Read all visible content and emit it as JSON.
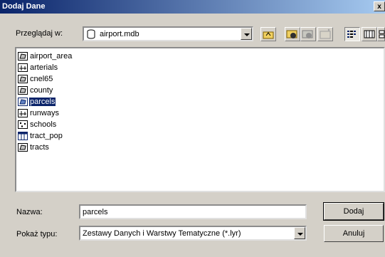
{
  "window": {
    "title": "Dodaj Dane",
    "close_glyph": "x"
  },
  "lookin": {
    "label": "Przeglądaj w:",
    "value": "airport.mdb",
    "icon": "database-icon"
  },
  "toolbar": {
    "buttons": [
      {
        "name": "up-one-level-icon"
      },
      {
        "name": "connect-folder-icon"
      },
      {
        "name": "disconnect-folder-icon"
      },
      {
        "name": "new-folder-icon"
      },
      {
        "name": "list-view-icon"
      },
      {
        "name": "details-view-icon"
      },
      {
        "name": "thumbnails-view-icon"
      }
    ]
  },
  "files": [
    {
      "label": "airport_area",
      "icon": "polygon-layer-icon",
      "selected": false
    },
    {
      "label": "arterials",
      "icon": "line-layer-icon",
      "selected": false
    },
    {
      "label": "cnel65",
      "icon": "polygon-layer-icon",
      "selected": false
    },
    {
      "label": "county",
      "icon": "polygon-layer-icon",
      "selected": false
    },
    {
      "label": "parcels",
      "icon": "polygon-layer-icon",
      "selected": true
    },
    {
      "label": "runways",
      "icon": "line-layer-icon",
      "selected": false
    },
    {
      "label": "schools",
      "icon": "point-layer-icon",
      "selected": false
    },
    {
      "label": "tract_pop",
      "icon": "table-icon",
      "selected": false
    },
    {
      "label": "tracts",
      "icon": "polygon-layer-icon",
      "selected": false
    }
  ],
  "name_field": {
    "label": "Nazwa:",
    "value": "parcels"
  },
  "type_field": {
    "label": "Pokaż typu:",
    "value": "Zestawy Danych i Warstwy Tematyczne (*.lyr)"
  },
  "buttons": {
    "ok": "Dodaj",
    "cancel": "Anuluj"
  }
}
